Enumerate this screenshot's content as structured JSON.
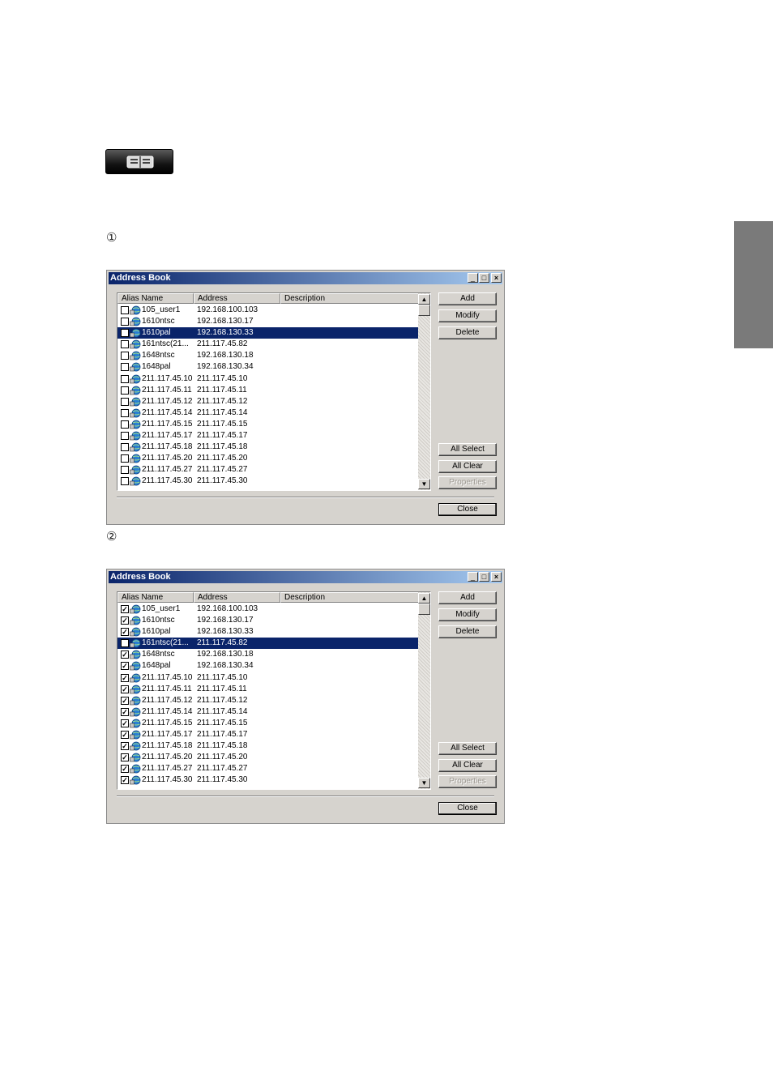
{
  "step1_marker": "①",
  "step2_marker": "②",
  "icons": {
    "toolbar": "address-book-icon",
    "row": "globe-computer-icon"
  },
  "dialogs": [
    {
      "title": "Address Book",
      "columns": {
        "alias": "Alias Name",
        "address": "Address",
        "description": "Description"
      },
      "buttons": {
        "add": "Add",
        "modify": "Modify",
        "delete": "Delete",
        "all_select": "All Select",
        "all_clear": "All Clear",
        "properties": "Properties",
        "close": "Close"
      },
      "rows": [
        {
          "alias": "105_user1",
          "address": "192.168.100.103",
          "checked": false,
          "selected": false
        },
        {
          "alias": "1610ntsc",
          "address": "192.168.130.17",
          "checked": false,
          "selected": false
        },
        {
          "alias": "1610pal",
          "address": "192.168.130.33",
          "checked": false,
          "selected": true
        },
        {
          "alias": "161ntsc(21...",
          "address": "211.117.45.82",
          "checked": false,
          "selected": false
        },
        {
          "alias": "1648ntsc",
          "address": "192.168.130.18",
          "checked": false,
          "selected": false
        },
        {
          "alias": "1648pal",
          "address": "192.168.130.34",
          "checked": false,
          "selected": false
        },
        {
          "alias": "211.117.45.10",
          "address": "211.117.45.10",
          "checked": false,
          "selected": false
        },
        {
          "alias": "211.117.45.11",
          "address": "211.117.45.11",
          "checked": false,
          "selected": false
        },
        {
          "alias": "211.117.45.12",
          "address": "211.117.45.12",
          "checked": false,
          "selected": false
        },
        {
          "alias": "211.117.45.14",
          "address": "211.117.45.14",
          "checked": false,
          "selected": false
        },
        {
          "alias": "211.117.45.15",
          "address": "211.117.45.15",
          "checked": false,
          "selected": false
        },
        {
          "alias": "211.117.45.17",
          "address": "211.117.45.17",
          "checked": false,
          "selected": false
        },
        {
          "alias": "211.117.45.18",
          "address": "211.117.45.18",
          "checked": false,
          "selected": false
        },
        {
          "alias": "211.117.45.20",
          "address": "211.117.45.20",
          "checked": false,
          "selected": false
        },
        {
          "alias": "211.117.45.27",
          "address": "211.117.45.27",
          "checked": false,
          "selected": false
        },
        {
          "alias": "211.117.45.30",
          "address": "211.117.45.30",
          "checked": false,
          "selected": false
        }
      ]
    },
    {
      "title": "Address Book",
      "columns": {
        "alias": "Alias Name",
        "address": "Address",
        "description": "Description"
      },
      "buttons": {
        "add": "Add",
        "modify": "Modify",
        "delete": "Delete",
        "all_select": "All Select",
        "all_clear": "All Clear",
        "properties": "Properties",
        "close": "Close"
      },
      "rows": [
        {
          "alias": "105_user1",
          "address": "192.168.100.103",
          "checked": true,
          "selected": false
        },
        {
          "alias": "1610ntsc",
          "address": "192.168.130.17",
          "checked": true,
          "selected": false
        },
        {
          "alias": "1610pal",
          "address": "192.168.130.33",
          "checked": true,
          "selected": false
        },
        {
          "alias": "161ntsc(21...",
          "address": "211.117.45.82",
          "checked": false,
          "selected": true
        },
        {
          "alias": "1648ntsc",
          "address": "192.168.130.18",
          "checked": true,
          "selected": false
        },
        {
          "alias": "1648pal",
          "address": "192.168.130.34",
          "checked": true,
          "selected": false
        },
        {
          "alias": "211.117.45.10",
          "address": "211.117.45.10",
          "checked": true,
          "selected": false
        },
        {
          "alias": "211.117.45.11",
          "address": "211.117.45.11",
          "checked": true,
          "selected": false
        },
        {
          "alias": "211.117.45.12",
          "address": "211.117.45.12",
          "checked": true,
          "selected": false
        },
        {
          "alias": "211.117.45.14",
          "address": "211.117.45.14",
          "checked": true,
          "selected": false
        },
        {
          "alias": "211.117.45.15",
          "address": "211.117.45.15",
          "checked": true,
          "selected": false
        },
        {
          "alias": "211.117.45.17",
          "address": "211.117.45.17",
          "checked": true,
          "selected": false
        },
        {
          "alias": "211.117.45.18",
          "address": "211.117.45.18",
          "checked": true,
          "selected": false
        },
        {
          "alias": "211.117.45.20",
          "address": "211.117.45.20",
          "checked": true,
          "selected": false
        },
        {
          "alias": "211.117.45.27",
          "address": "211.117.45.27",
          "checked": true,
          "selected": false
        },
        {
          "alias": "211.117.45.30",
          "address": "211.117.45.30",
          "checked": true,
          "selected": false
        }
      ]
    }
  ]
}
